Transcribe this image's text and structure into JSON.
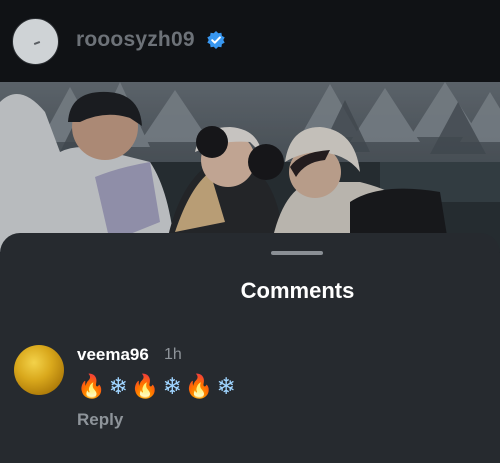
{
  "header": {
    "username": "rooosyzh09",
    "verified_color": "#3897f0"
  },
  "sheet": {
    "title": "Comments"
  },
  "comment": {
    "username": "veema96",
    "time": "1h",
    "emojis": [
      "🔥",
      "❄",
      "🔥",
      "❄",
      "🔥",
      "❄"
    ],
    "reply_label": "Reply"
  }
}
